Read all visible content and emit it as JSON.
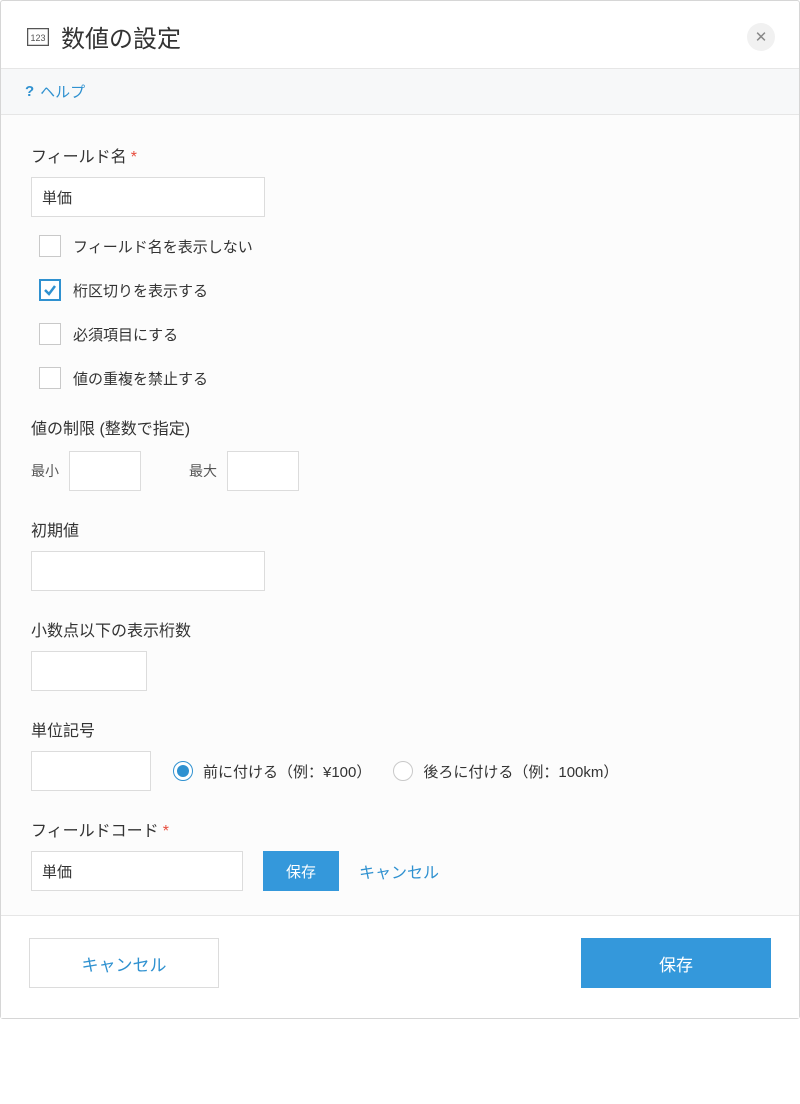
{
  "dialog": {
    "title": "数値の設定",
    "help_label": "ヘルプ"
  },
  "field_name": {
    "label": "フィールド名",
    "required_mark": "*",
    "value": "単価"
  },
  "options": {
    "hide_label": "フィールド名を表示しない",
    "digit_sep": "桁区切りを表示する",
    "required": "必須項目にする",
    "unique": "値の重複を禁止する",
    "checked": {
      "hide_label": false,
      "digit_sep": true,
      "required": false,
      "unique": false
    }
  },
  "limit": {
    "label": "値の制限 (整数で指定)",
    "min_label": "最小",
    "max_label": "最大",
    "min_value": "",
    "max_value": ""
  },
  "default_value": {
    "label": "初期値",
    "value": ""
  },
  "decimal_places": {
    "label": "小数点以下の表示桁数",
    "value": ""
  },
  "unit": {
    "label": "単位記号",
    "value": "",
    "prefix_label": "前に付ける（例：¥100）",
    "suffix_label": "後ろに付ける（例：100km）",
    "selected": "prefix"
  },
  "field_code": {
    "label": "フィールドコード",
    "required_mark": "*",
    "value": "単価",
    "save_label": "保存",
    "cancel_label": "キャンセル"
  },
  "footer": {
    "cancel": "キャンセル",
    "save": "保存"
  }
}
